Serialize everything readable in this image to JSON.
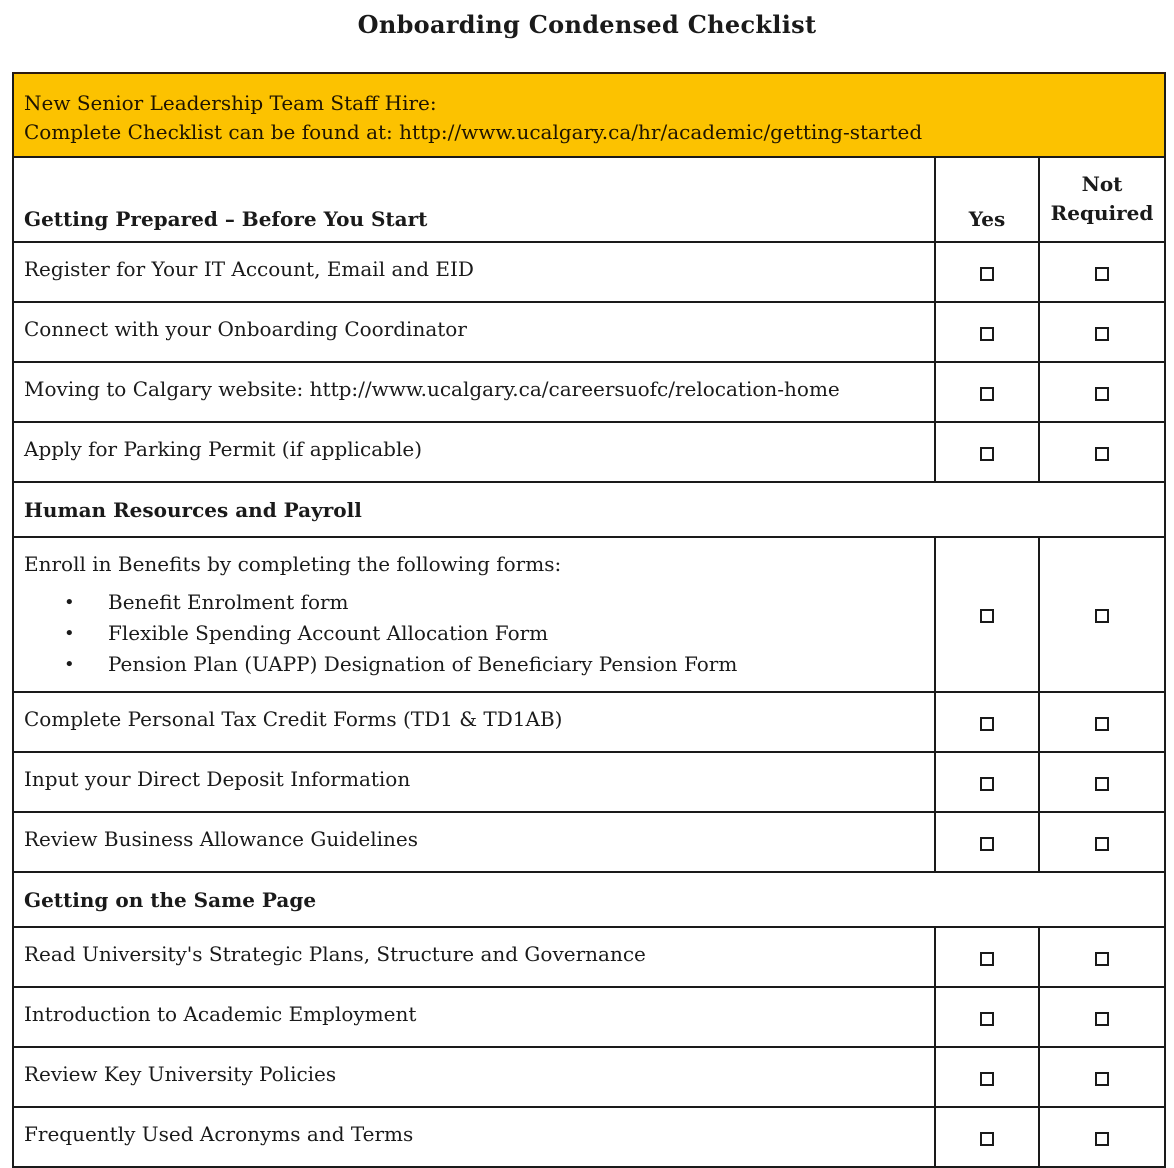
{
  "document": {
    "title": "Onboarding Condensed Checklist"
  },
  "banner": {
    "line1": "New Senior Leadership Team Staff Hire:",
    "line2": "Complete Checklist can be found at: http://www.ucalgary.ca/hr/academic/getting-started",
    "background_color": "#fcc200"
  },
  "columns": {
    "yes": "Yes",
    "not_required_line1": "Not",
    "not_required_line2": "Required"
  },
  "sections": [
    {
      "title": "Getting Prepared – Before You Start",
      "items": [
        {
          "label": "Register for Your IT Account, Email and EID",
          "yes": false,
          "not_required": false
        },
        {
          "label": "Connect with your Onboarding Coordinator",
          "yes": false,
          "not_required": false
        },
        {
          "label": "Moving to Calgary website: http://www.ucalgary.ca/careersuofc/relocation-home",
          "yes": false,
          "not_required": false
        },
        {
          "label": "Apply for Parking Permit (if applicable)",
          "yes": false,
          "not_required": false
        }
      ]
    },
    {
      "title": "Human Resources and Payroll",
      "items": [
        {
          "label": "Enroll in Benefits by completing the following forms:",
          "subitems": [
            "Benefit Enrolment form",
            "Flexible Spending Account Allocation Form",
            "Pension Plan (UAPP) Designation of Beneficiary Pension Form"
          ],
          "yes": false,
          "not_required": false
        },
        {
          "label": "Complete Personal Tax Credit Forms (TD1 & TD1AB)",
          "yes": false,
          "not_required": false
        },
        {
          "label": "Input your Direct Deposit Information",
          "yes": false,
          "not_required": false
        },
        {
          "label": "Review Business Allowance Guidelines",
          "yes": false,
          "not_required": false
        }
      ]
    },
    {
      "title": "Getting on the Same Page",
      "items": [
        {
          "label": "Read University's Strategic Plans, Structure and Governance",
          "yes": false,
          "not_required": false
        },
        {
          "label": "Introduction to Academic Employment",
          "yes": false,
          "not_required": false
        },
        {
          "label": "Review Key University Policies",
          "yes": false,
          "not_required": false
        },
        {
          "label": "Frequently Used Acronyms and Terms",
          "yes": false,
          "not_required": false
        }
      ]
    }
  ],
  "icons": {
    "checkbox": "empty-square",
    "bullet": "•"
  }
}
